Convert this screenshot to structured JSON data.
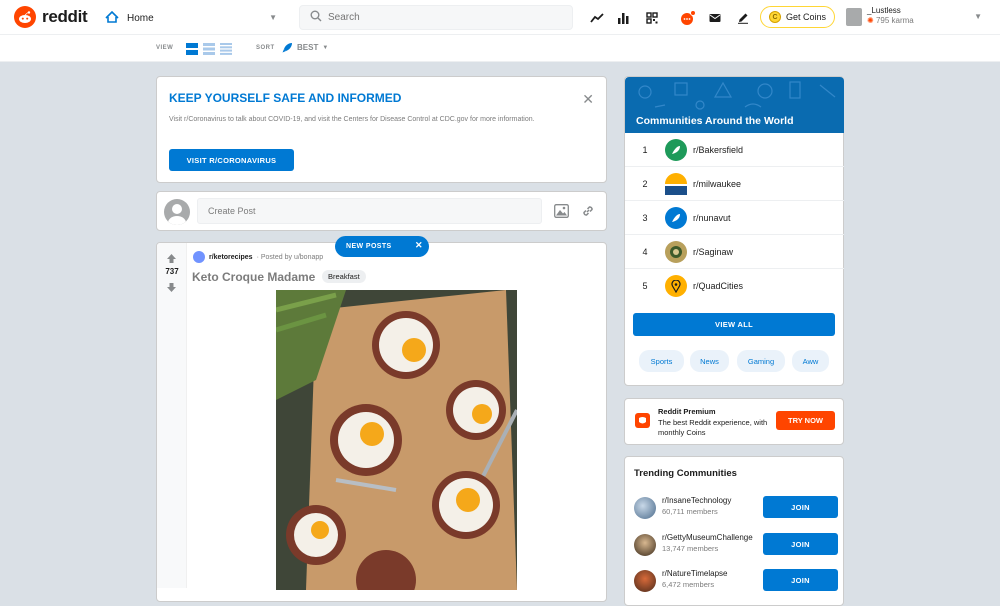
{
  "header": {
    "logo_text": "reddit",
    "home_label": "Home",
    "search_placeholder": "Search",
    "get_coins_label": "Get Coins",
    "username": "_Lustless",
    "karma": "795 karma",
    "brand_color": "#ff4500"
  },
  "subbar": {
    "view_label": "VIEW",
    "sort_label": "SORT",
    "sort_value": "BEST"
  },
  "banner": {
    "title": "KEEP YOURSELF SAFE AND INFORMED",
    "text": "Visit r/Coronavirus to talk about COVID-19, and visit the Centers for Disease Control at CDC.gov for more information.",
    "button_label": "VISIT R/CORONAVIRUS"
  },
  "create_post": {
    "placeholder": "Create Post"
  },
  "new_posts": {
    "label": "NEW POSTS",
    "close": "✕"
  },
  "post": {
    "subreddit": "r/ketorecipes",
    "posted_by": "· Posted by u/bonapp",
    "votes": "737",
    "title": "Keto Croque Madame",
    "flair": "Breakfast"
  },
  "communities": {
    "title": "Communities Around the World",
    "items": [
      {
        "rank": "1",
        "name": "r/Bakersfield",
        "color": "#1e9a5a"
      },
      {
        "rank": "2",
        "name": "r/milwaukee",
        "color": "#ffb000"
      },
      {
        "rank": "3",
        "name": "r/nunavut",
        "color": "#0079d3"
      },
      {
        "rank": "4",
        "name": "r/Saginaw",
        "color": "#b8a05c"
      },
      {
        "rank": "5",
        "name": "r/QuadCities",
        "color": "#ffb000"
      }
    ],
    "view_all": "VIEW ALL",
    "pills": [
      "Sports",
      "News",
      "Gaming",
      "Aww"
    ]
  },
  "premium": {
    "title": "Reddit Premium",
    "text": "The best Reddit experience, with monthly Coins",
    "button": "TRY NOW"
  },
  "trending": {
    "title": "Trending Communities",
    "items": [
      {
        "name": "r/InsaneTechnology",
        "members": "60,711 members",
        "join": "JOIN"
      },
      {
        "name": "r/GettyMuseumChallenge",
        "members": "13,747 members",
        "join": "JOIN"
      },
      {
        "name": "r/NatureTimelapse",
        "members": "6,472 members",
        "join": "JOIN"
      }
    ]
  }
}
